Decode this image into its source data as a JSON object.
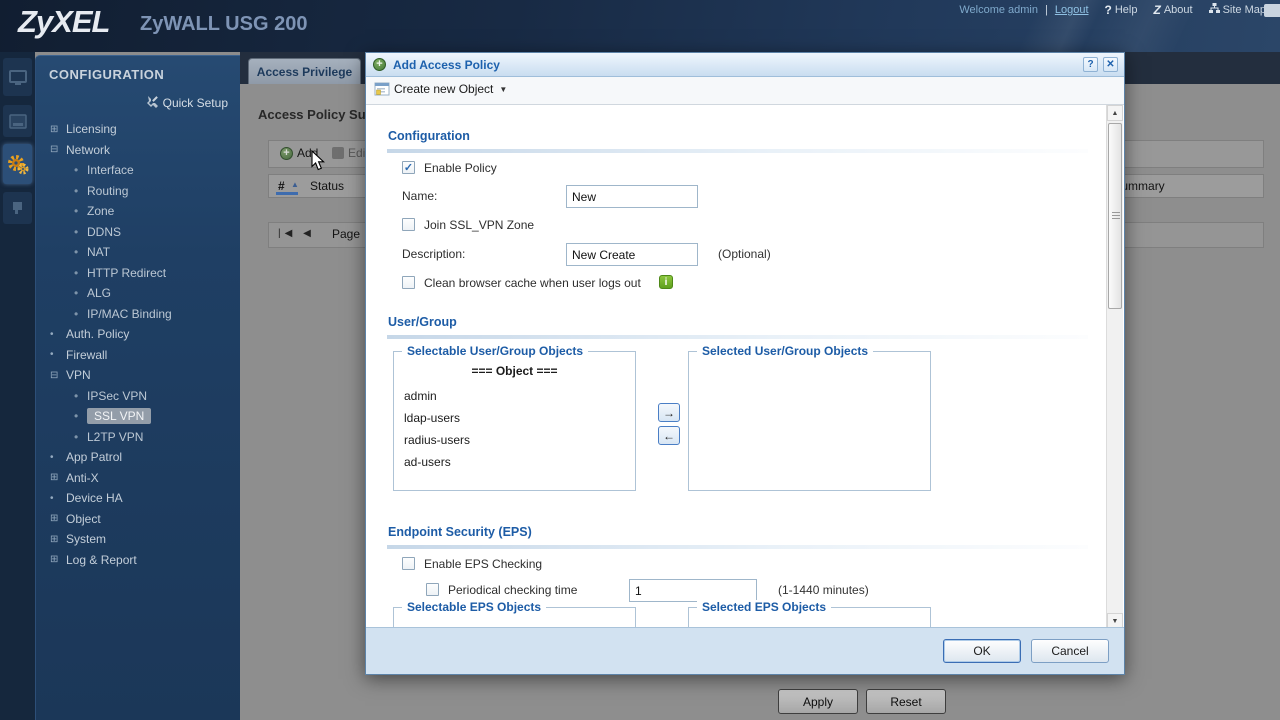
{
  "banner": {
    "brand": "ZyXEL",
    "product": "ZyWALL USG 200",
    "welcome": "Welcome admin",
    "sep": "|",
    "logout": "Logout",
    "help_glyph": "?",
    "help": "Help",
    "about_glyph": "Z",
    "about": "About",
    "site_map": "Site Map"
  },
  "sidebar": {
    "title": "CONFIGURATION",
    "quick_setup": "Quick Setup",
    "items": [
      {
        "glyph": "⊞",
        "label": "Licensing"
      },
      {
        "glyph": "⊟",
        "label": "Network"
      },
      {
        "glyph": "•",
        "label": "Interface"
      },
      {
        "glyph": "•",
        "label": "Routing"
      },
      {
        "glyph": "•",
        "label": "Zone"
      },
      {
        "glyph": "•",
        "label": "DDNS"
      },
      {
        "glyph": "•",
        "label": "NAT"
      },
      {
        "glyph": "•",
        "label": "HTTP Redirect"
      },
      {
        "glyph": "•",
        "label": "ALG"
      },
      {
        "glyph": "•",
        "label": "IP/MAC Binding"
      },
      {
        "glyph": "•",
        "label": "Auth. Policy"
      },
      {
        "glyph": "•",
        "label": "Firewall"
      },
      {
        "glyph": "⊟",
        "label": "VPN"
      },
      {
        "glyph": "•",
        "label": "IPSec VPN"
      },
      {
        "glyph": "•",
        "label": "SSL VPN"
      },
      {
        "glyph": "•",
        "label": "L2TP VPN"
      },
      {
        "glyph": "•",
        "label": "App Patrol"
      },
      {
        "glyph": "⊞",
        "label": "Anti-X"
      },
      {
        "glyph": "•",
        "label": "Device HA"
      },
      {
        "glyph": "⊞",
        "label": "Object"
      },
      {
        "glyph": "⊞",
        "label": "System"
      },
      {
        "glyph": "⊞",
        "label": "Log & Report"
      }
    ]
  },
  "background": {
    "tab": "Access Privilege",
    "page_title": "Access Policy Summary",
    "add_label": "Add",
    "add_glyph": "+",
    "edit_label": "Edit",
    "col_num": "#",
    "sort_glyph": "▲",
    "col_status": "Status",
    "col_policy_summary": "Policy Summary",
    "nav_glyphs": "|◀ ◀",
    "page_label": "Page",
    "apply_label": "Apply",
    "reset_label": "Reset"
  },
  "modal": {
    "title": "Add Access Policy",
    "title_glyph": "+",
    "help_glyph": "?",
    "close_glyph": "✕",
    "toolbar": {
      "create_new_object": "Create new Object",
      "caret": "▼"
    },
    "scroll_up": "▲",
    "scroll_down": "▼",
    "config": {
      "section": "Configuration",
      "enable_policy": "Enable Policy",
      "enable_check": "✓",
      "name_label": "Name:",
      "name_value": "New",
      "join_zone": "Join SSL_VPN Zone",
      "description_label": "Description:",
      "description_value": "New Create",
      "optional": "(Optional)",
      "clean_cache": "Clean browser cache when user logs out",
      "info_glyph": "i"
    },
    "user_group": {
      "section": "User/Group",
      "selectable_legend": "Selectable User/Group Objects",
      "selected_legend": "Selected User/Group Objects",
      "object_header": "=== Object ===",
      "objects": [
        "admin",
        "ldap-users",
        "radius-users",
        "ad-users"
      ],
      "add_arrow": "→",
      "remove_arrow": "←"
    },
    "eps": {
      "section": "Endpoint Security (EPS)",
      "enable": "Enable EPS Checking",
      "periodical": "Periodical checking time",
      "time_value": "1",
      "range_hint": "(1-1440 minutes)",
      "selectable_legend": "Selectable EPS Objects",
      "selected_legend": "Selected EPS Objects"
    },
    "ok_label": "OK",
    "cancel_label": "Cancel"
  }
}
